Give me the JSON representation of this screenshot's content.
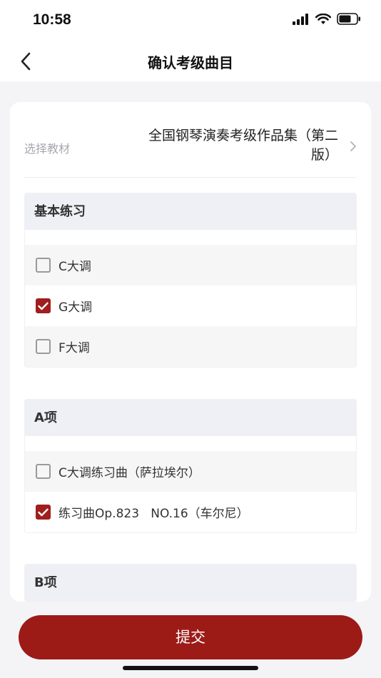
{
  "status_bar": {
    "time": "10:58"
  },
  "nav": {
    "title": "确认考级曲目"
  },
  "material": {
    "label": "选择教材",
    "value": "全国钢琴演奏考级作品集（第二版）"
  },
  "sections": [
    {
      "title": "基本练习",
      "items": [
        {
          "label": "C大调",
          "checked": false
        },
        {
          "label": "G大调",
          "checked": true
        },
        {
          "label": "F大调",
          "checked": false
        }
      ]
    },
    {
      "title": "A项",
      "items": [
        {
          "label": "C大调练习曲（萨拉埃尔）",
          "checked": false
        },
        {
          "label": "练习曲Op.823   NO.16（车尔尼）",
          "checked": true
        }
      ]
    },
    {
      "title": "B项",
      "items": []
    }
  ],
  "submit": {
    "label": "提交"
  },
  "colors": {
    "accent": "#9c1b17",
    "section_header_bg": "#eef0f5"
  },
  "icons": {
    "back": "chevron-left-icon",
    "material_arrow": "chevron-right-icon",
    "check": "checkmark-icon"
  }
}
